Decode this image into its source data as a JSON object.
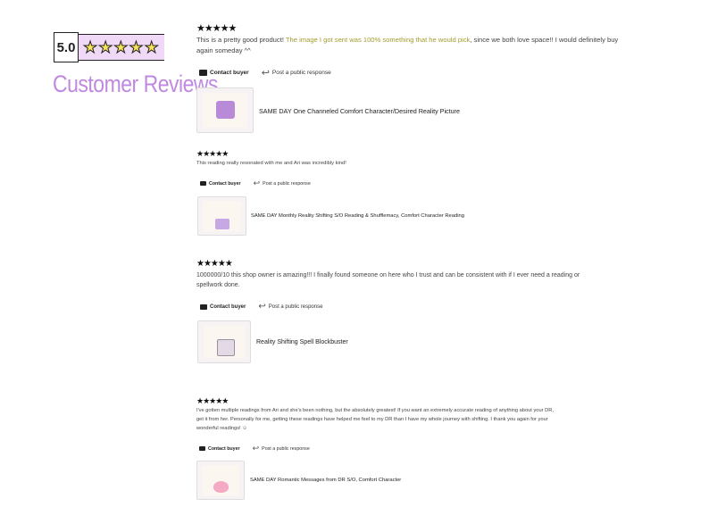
{
  "badge": {
    "score": "5.0",
    "stars": "★★★★★"
  },
  "section_title": "Customer Reviews",
  "actions": {
    "contact": "Contact buyer",
    "reply": "Post a public response"
  },
  "reviews": [
    {
      "stars": "★★★★★",
      "text_before": "This is a pretty good product! ",
      "text_highlight": "The image I got sent was 100% something that he would pick",
      "text_after": ", since we both love space!! I would definitely buy again someday ^^",
      "product": "SAME DAY One Channeled Comfort Character/Desired Reality Picture"
    },
    {
      "stars": "★★★★★",
      "text": "This reading really resonated with me and Ari was incredibly kind!",
      "product": "SAME DAY Monthly Reality Shifting S/O Reading & Shufflemacy, Comfort Character Reading"
    },
    {
      "stars": "★★★★★",
      "text": "1000000/10 this shop owner is amazing!!! I finally found someone on here who I trust and can be consistent with if I ever need a reading or spellwork done.",
      "product": "Reality Shifting Spell Blockbuster"
    },
    {
      "stars": "★★★★★",
      "text": "I've gotten multiple readings from Ari and she's been nothing, but the absolutely greatest! If you want an extremely accurate reading of anything about your DR, get it from her. Personally for me, getting these readings have helped me feel to my DR than I have my whole journey with shifting. I thank you again for your wonderful readings! ☺",
      "product": "SAME DAY Romantic Messages from DR S/O, Comfort Character"
    }
  ]
}
